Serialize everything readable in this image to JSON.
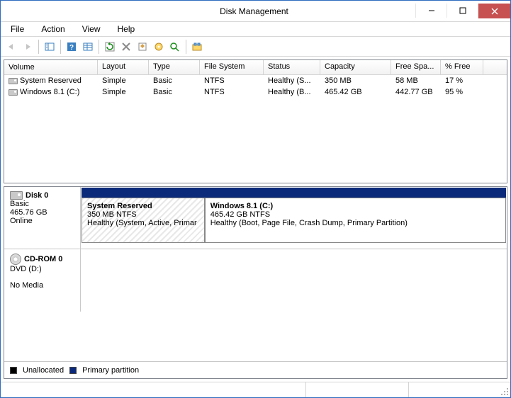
{
  "window": {
    "title": "Disk Management"
  },
  "menu": {
    "file": "File",
    "action": "Action",
    "view": "View",
    "help": "Help"
  },
  "columns": {
    "volume": "Volume",
    "layout": "Layout",
    "type": "Type",
    "filesystem": "File System",
    "status": "Status",
    "capacity": "Capacity",
    "freespace": "Free Spa...",
    "pctfree": "% Free"
  },
  "volumes": [
    {
      "name": "System Reserved",
      "layout": "Simple",
      "type": "Basic",
      "fs": "NTFS",
      "status": "Healthy (S...",
      "capacity": "350 MB",
      "free": "58 MB",
      "pct": "17 %"
    },
    {
      "name": "Windows 8.1 (C:)",
      "layout": "Simple",
      "type": "Basic",
      "fs": "NTFS",
      "status": "Healthy (B...",
      "capacity": "465.42 GB",
      "free": "442.77 GB",
      "pct": "95 %"
    }
  ],
  "disks": [
    {
      "id": "Disk 0",
      "type": "Basic",
      "size": "465.76 GB",
      "status": "Online",
      "icon": "disk",
      "partitions": [
        {
          "name": "System Reserved",
          "info": "350 MB NTFS",
          "status": "Healthy (System, Active, Primar",
          "hatched": true,
          "widthpct": 29
        },
        {
          "name": "Windows 8.1  (C:)",
          "info": "465.42 GB NTFS",
          "status": "Healthy (Boot, Page File, Crash Dump, Primary Partition)",
          "hatched": false,
          "widthpct": 71
        }
      ]
    },
    {
      "id": "CD-ROM 0",
      "type": "DVD (D:)",
      "size": "",
      "status": "No Media",
      "icon": "cd",
      "partitions": []
    }
  ],
  "legend": {
    "unallocated": "Unallocated",
    "primary": "Primary partition"
  }
}
